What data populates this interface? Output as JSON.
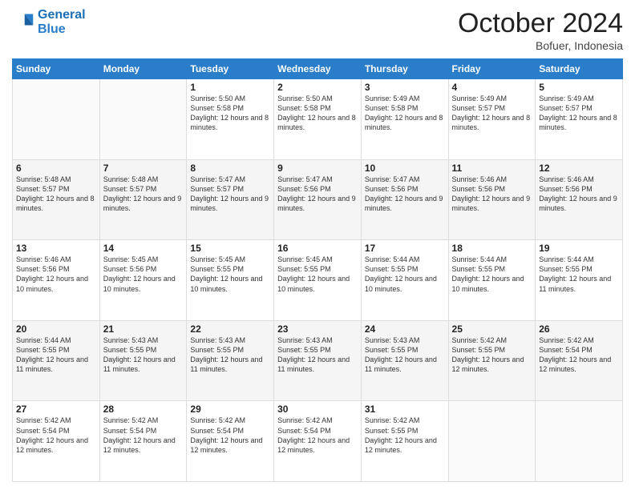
{
  "header": {
    "logo_line1": "General",
    "logo_line2": "Blue",
    "month": "October 2024",
    "location": "Bofuer, Indonesia"
  },
  "days_of_week": [
    "Sunday",
    "Monday",
    "Tuesday",
    "Wednesday",
    "Thursday",
    "Friday",
    "Saturday"
  ],
  "weeks": [
    [
      {
        "day": "",
        "info": ""
      },
      {
        "day": "",
        "info": ""
      },
      {
        "day": "1",
        "info": "Sunrise: 5:50 AM\nSunset: 5:58 PM\nDaylight: 12 hours and 8 minutes."
      },
      {
        "day": "2",
        "info": "Sunrise: 5:50 AM\nSunset: 5:58 PM\nDaylight: 12 hours and 8 minutes."
      },
      {
        "day": "3",
        "info": "Sunrise: 5:49 AM\nSunset: 5:58 PM\nDaylight: 12 hours and 8 minutes."
      },
      {
        "day": "4",
        "info": "Sunrise: 5:49 AM\nSunset: 5:57 PM\nDaylight: 12 hours and 8 minutes."
      },
      {
        "day": "5",
        "info": "Sunrise: 5:49 AM\nSunset: 5:57 PM\nDaylight: 12 hours and 8 minutes."
      }
    ],
    [
      {
        "day": "6",
        "info": "Sunrise: 5:48 AM\nSunset: 5:57 PM\nDaylight: 12 hours and 8 minutes."
      },
      {
        "day": "7",
        "info": "Sunrise: 5:48 AM\nSunset: 5:57 PM\nDaylight: 12 hours and 9 minutes."
      },
      {
        "day": "8",
        "info": "Sunrise: 5:47 AM\nSunset: 5:57 PM\nDaylight: 12 hours and 9 minutes."
      },
      {
        "day": "9",
        "info": "Sunrise: 5:47 AM\nSunset: 5:56 PM\nDaylight: 12 hours and 9 minutes."
      },
      {
        "day": "10",
        "info": "Sunrise: 5:47 AM\nSunset: 5:56 PM\nDaylight: 12 hours and 9 minutes."
      },
      {
        "day": "11",
        "info": "Sunrise: 5:46 AM\nSunset: 5:56 PM\nDaylight: 12 hours and 9 minutes."
      },
      {
        "day": "12",
        "info": "Sunrise: 5:46 AM\nSunset: 5:56 PM\nDaylight: 12 hours and 9 minutes."
      }
    ],
    [
      {
        "day": "13",
        "info": "Sunrise: 5:46 AM\nSunset: 5:56 PM\nDaylight: 12 hours and 10 minutes."
      },
      {
        "day": "14",
        "info": "Sunrise: 5:45 AM\nSunset: 5:56 PM\nDaylight: 12 hours and 10 minutes."
      },
      {
        "day": "15",
        "info": "Sunrise: 5:45 AM\nSunset: 5:55 PM\nDaylight: 12 hours and 10 minutes."
      },
      {
        "day": "16",
        "info": "Sunrise: 5:45 AM\nSunset: 5:55 PM\nDaylight: 12 hours and 10 minutes."
      },
      {
        "day": "17",
        "info": "Sunrise: 5:44 AM\nSunset: 5:55 PM\nDaylight: 12 hours and 10 minutes."
      },
      {
        "day": "18",
        "info": "Sunrise: 5:44 AM\nSunset: 5:55 PM\nDaylight: 12 hours and 10 minutes."
      },
      {
        "day": "19",
        "info": "Sunrise: 5:44 AM\nSunset: 5:55 PM\nDaylight: 12 hours and 11 minutes."
      }
    ],
    [
      {
        "day": "20",
        "info": "Sunrise: 5:44 AM\nSunset: 5:55 PM\nDaylight: 12 hours and 11 minutes."
      },
      {
        "day": "21",
        "info": "Sunrise: 5:43 AM\nSunset: 5:55 PM\nDaylight: 12 hours and 11 minutes."
      },
      {
        "day": "22",
        "info": "Sunrise: 5:43 AM\nSunset: 5:55 PM\nDaylight: 12 hours and 11 minutes."
      },
      {
        "day": "23",
        "info": "Sunrise: 5:43 AM\nSunset: 5:55 PM\nDaylight: 12 hours and 11 minutes."
      },
      {
        "day": "24",
        "info": "Sunrise: 5:43 AM\nSunset: 5:55 PM\nDaylight: 12 hours and 11 minutes."
      },
      {
        "day": "25",
        "info": "Sunrise: 5:42 AM\nSunset: 5:55 PM\nDaylight: 12 hours and 12 minutes."
      },
      {
        "day": "26",
        "info": "Sunrise: 5:42 AM\nSunset: 5:54 PM\nDaylight: 12 hours and 12 minutes."
      }
    ],
    [
      {
        "day": "27",
        "info": "Sunrise: 5:42 AM\nSunset: 5:54 PM\nDaylight: 12 hours and 12 minutes."
      },
      {
        "day": "28",
        "info": "Sunrise: 5:42 AM\nSunset: 5:54 PM\nDaylight: 12 hours and 12 minutes."
      },
      {
        "day": "29",
        "info": "Sunrise: 5:42 AM\nSunset: 5:54 PM\nDaylight: 12 hours and 12 minutes."
      },
      {
        "day": "30",
        "info": "Sunrise: 5:42 AM\nSunset: 5:54 PM\nDaylight: 12 hours and 12 minutes."
      },
      {
        "day": "31",
        "info": "Sunrise: 5:42 AM\nSunset: 5:55 PM\nDaylight: 12 hours and 12 minutes."
      },
      {
        "day": "",
        "info": ""
      },
      {
        "day": "",
        "info": ""
      }
    ]
  ]
}
